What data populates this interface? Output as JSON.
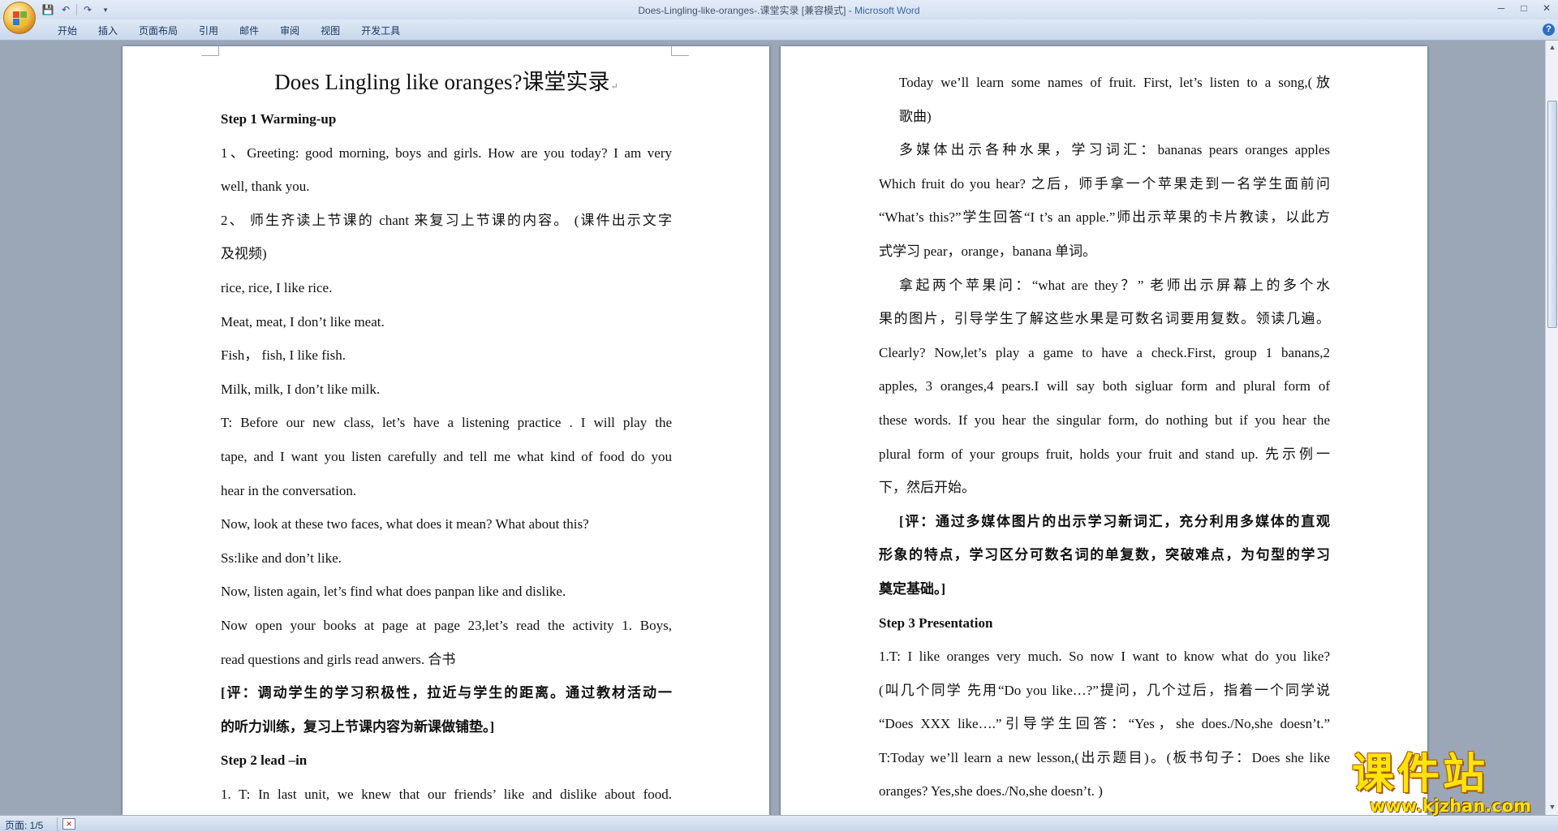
{
  "window": {
    "title": "Does-Lingling-like-oranges-.课堂实录 [兼容模式] - ",
    "app_name": "Microsoft Word",
    "controls": [
      "─",
      "□",
      "✕"
    ]
  },
  "quick_access": {
    "save": "💾",
    "undo": "↶",
    "redo": "↷",
    "customize": "▾"
  },
  "ribbon": {
    "tabs": [
      "开始",
      "插入",
      "页面布局",
      "引用",
      "邮件",
      "审阅",
      "视图",
      "开发工具"
    ],
    "help": "?"
  },
  "left_page": {
    "title": "Does Lingling like oranges?课堂实录",
    "lines": [
      {
        "text": "Step 1 Warming-up",
        "style": "bold"
      },
      {
        "text": "1、Greeting: good morning, boys and girls. How are you today? I am very",
        "style": "justify"
      },
      {
        "text": "well, thank you.",
        "style": "plain"
      },
      {
        "text": "2、 师生齐读上节课的 chant 来复习上节课的内容。 (课件出示文字",
        "style": "justify"
      },
      {
        "text": "及视频)",
        "style": "plain"
      },
      {
        "text": "rice, rice, I like rice.",
        "style": "plain"
      },
      {
        "text": "Meat, meat, I don’t like meat.",
        "style": "plain"
      },
      {
        "text": "Fish， fish, I like fish.",
        "style": "plain"
      },
      {
        "text": "Milk, milk, I don’t like milk.",
        "style": "plain"
      },
      {
        "text": "T: Before our new class, let’s have a listening practice . I will play the",
        "style": "justify"
      },
      {
        "text": "tape, and I want you listen carefully and tell me what kind of food do you",
        "style": "justify"
      },
      {
        "text": "hear in the conversation.",
        "style": "plain"
      },
      {
        "text": "Now, look at these two faces, what does it mean? What about this? ",
        "style": "plain"
      },
      {
        "text": "Ss:like and don’t like.",
        "style": "plain"
      },
      {
        "text": "Now, listen again, let’s find what does panpan like and dislike.",
        "style": "plain"
      },
      {
        "text": "Now open your books at    page at page 23,let’s read the activity 1. Boys,",
        "style": "justify"
      },
      {
        "text": "read questions and girls read anwers. 合书",
        "style": "plain"
      },
      {
        "text": "[评：调动学生的学习积极性，拉近与学生的距离。通过教材活动一",
        "style": "bold-justify"
      },
      {
        "text": "的听力训练，复习上节课内容为新课做铺垫。]",
        "style": "bold"
      },
      {
        "text": "Step 2 lead –in  ",
        "style": "bold"
      },
      {
        "text": "1.  T:   In last unit, we knew that our friends’ like and dislike about food.",
        "style": "justify"
      }
    ]
  },
  "right_page": {
    "lines": [
      {
        "text": "Today we’ll learn some names of fruit. First, let’s listen to a song,(放",
        "style": "justify-indent"
      },
      {
        "text": "歌曲) ",
        "style": "indent"
      },
      {
        "text": "多媒体出示各种水果，学习词汇：bananas    pears    oranges    apples",
        "style": "justify-indent"
      },
      {
        "text": "Which fruit do you hear?   之后，师手拿一个苹果走到一名学生面前问",
        "style": "justify"
      },
      {
        "text": "“What’s this?”学生回答“I t’s an apple.”师出示苹果的卡片教读，以此方",
        "style": "justify"
      },
      {
        "text": "式学习 pear，orange，banana 单词。",
        "style": "plain"
      },
      {
        "text": "拿起两个苹果问：“what are they？”   老师出示屏幕上的多个水",
        "style": "justify-indent"
      },
      {
        "text": "果的图片，引导学生了解这些水果是可数名词要用复数。领读几遍。",
        "style": "justify"
      },
      {
        "text": "Clearly?    Now,let’s play a game to have a check.First, group 1 banans,2",
        "style": "justify"
      },
      {
        "text": "apples, 3 oranges,4 pears.I will say both sigluar form and plural form of",
        "style": "justify"
      },
      {
        "text": "these words. If you hear the singular form, do nothing but if you hear the",
        "style": "justify"
      },
      {
        "text": "plural form of your groups fruit, holds your fruit and stand up. 先示例一",
        "style": "justify"
      },
      {
        "text": "下，然后开始。",
        "style": "plain"
      },
      {
        "text": "[评：通过多媒体图片的出示学习新词汇，充分利用多媒体的直观",
        "style": "bold-justify-indent"
      },
      {
        "text": "形象的特点，学习区分可数名词的单复数，突破难点，为句型的学习",
        "style": "bold-justify"
      },
      {
        "text": "奠定基础。]",
        "style": "bold"
      },
      {
        "text": " Step 3 Presentation",
        "style": "bold"
      },
      {
        "text": "1.T: I like oranges very much. So now I want to know what do you like?",
        "style": "justify"
      },
      {
        "text": "(叫几个同学  先用“Do you like…?”提问，几个过后，指着一个同学说",
        "style": "justify"
      },
      {
        "text": "“Does XXX like….”引导学生回答：“Yes，she does./No,she doesn’t.”",
        "style": "justify"
      },
      {
        "text": "T:Today we’ll learn a new lesson,(出示题目)。(板书句子：Does she like",
        "style": "justify"
      },
      {
        "text": "oranges? Yes,she does./No,she doesn’t. )",
        "style": "plain"
      }
    ]
  },
  "para_mark": "↵",
  "status": {
    "page": "页面: 1/5"
  },
  "watermark": {
    "cn": "课件站",
    "url": "www.kjzhan.com"
  }
}
